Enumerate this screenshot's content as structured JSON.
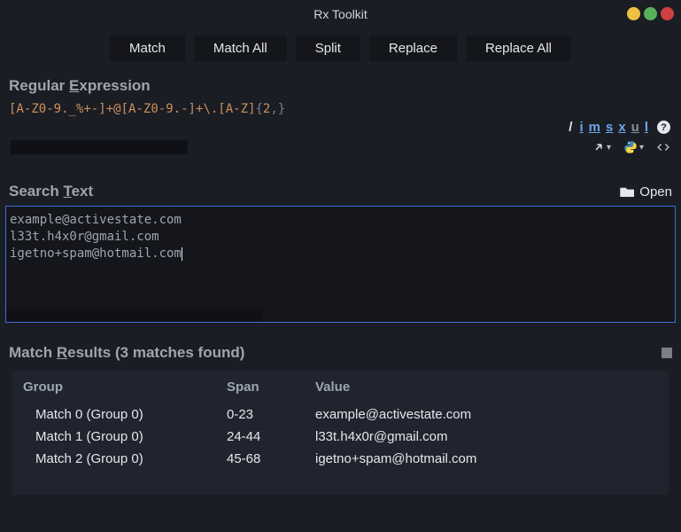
{
  "window": {
    "title": "Rx Toolkit"
  },
  "toolbar": {
    "match": "Match",
    "match_all": "Match All",
    "split": "Split",
    "replace": "Replace",
    "replace_all": "Replace All"
  },
  "regex": {
    "label_pre": "Regular ",
    "label_accel": "E",
    "label_post": "xpression",
    "pattern_display": "[A-Z0-9._%+-]+@[A-Z0-9.-]+\\.[A-Z]{2,}",
    "flags": {
      "i": "i",
      "m": "m",
      "s": "s",
      "x": "x",
      "u": "u",
      "l": "l"
    }
  },
  "search": {
    "label_pre": "Search ",
    "label_accel": "T",
    "label_post": "ext",
    "open_label": "Open",
    "text": "example@activestate.com\nl33t.h4x0r@gmail.com\nigetno+spam@hotmail.com"
  },
  "results": {
    "label_pre": "Match ",
    "label_accel": "R",
    "label_post": "esults",
    "count_text": "(3 matches found)",
    "headers": {
      "group": "Group",
      "span": "Span",
      "value": "Value"
    },
    "rows": [
      {
        "group": "Match 0 (Group 0)",
        "span": "0-23",
        "value": "example@activestate.com"
      },
      {
        "group": "Match 1 (Group 0)",
        "span": "24-44",
        "value": "l33t.h4x0r@gmail.com"
      },
      {
        "group": "Match 2 (Group 0)",
        "span": "45-68",
        "value": "igetno+spam@hotmail.com"
      }
    ]
  }
}
